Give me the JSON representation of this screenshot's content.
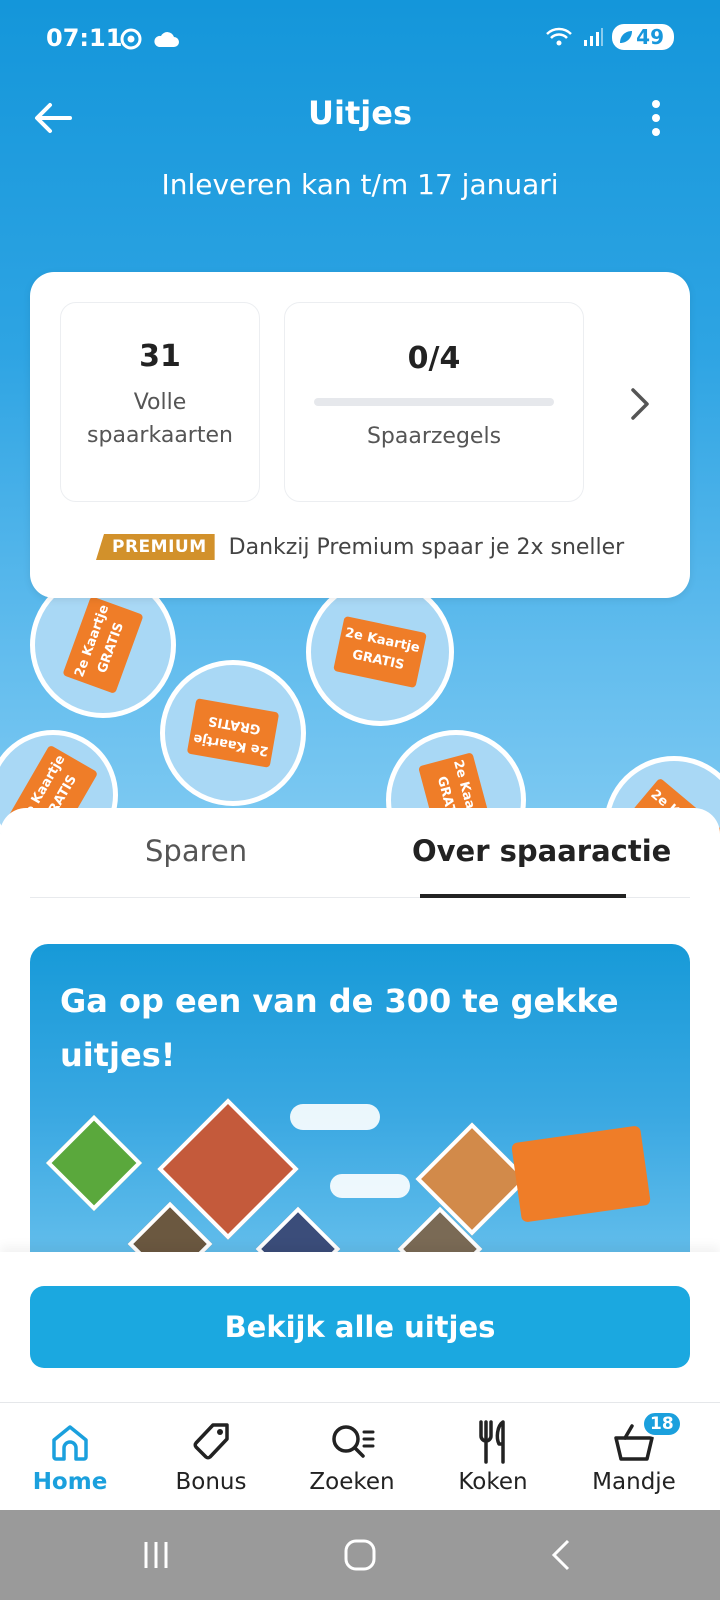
{
  "status_bar": {
    "time": "07:11",
    "battery": "49"
  },
  "header": {
    "title": "Uitjes",
    "subtitle": "Inleveren kan t/m 17 januari"
  },
  "card": {
    "full_cards": {
      "value": "31",
      "label_line1": "Volle",
      "label_line2": "spaarkaarten"
    },
    "stamps": {
      "value": "0/4",
      "label": "Spaarzegels",
      "progress": 0
    },
    "premium_badge": "PREMIUM",
    "premium_text": "Dankzij Premium spaar je 2x sneller"
  },
  "tabs": [
    {
      "label": "Sparen",
      "selected": false
    },
    {
      "label": "Over spaaractie",
      "selected": true
    }
  ],
  "promo": {
    "title": "Ga op een van de 300 te gekke uitjes!"
  },
  "cta": {
    "label": "Bekijk alle uitjes"
  },
  "bottom_nav": [
    {
      "label": "Home",
      "icon": "home-icon",
      "active": true
    },
    {
      "label": "Bonus",
      "icon": "tag-icon",
      "active": false
    },
    {
      "label": "Zoeken",
      "icon": "search-list-icon",
      "active": false
    },
    {
      "label": "Koken",
      "icon": "cutlery-icon",
      "active": false
    },
    {
      "label": "Mandje",
      "icon": "basket-icon",
      "active": false,
      "badge": "18"
    }
  ],
  "colors": {
    "brand_blue": "#179bd7",
    "accent_orange": "#ef7d28",
    "premium": "#d2912b"
  }
}
